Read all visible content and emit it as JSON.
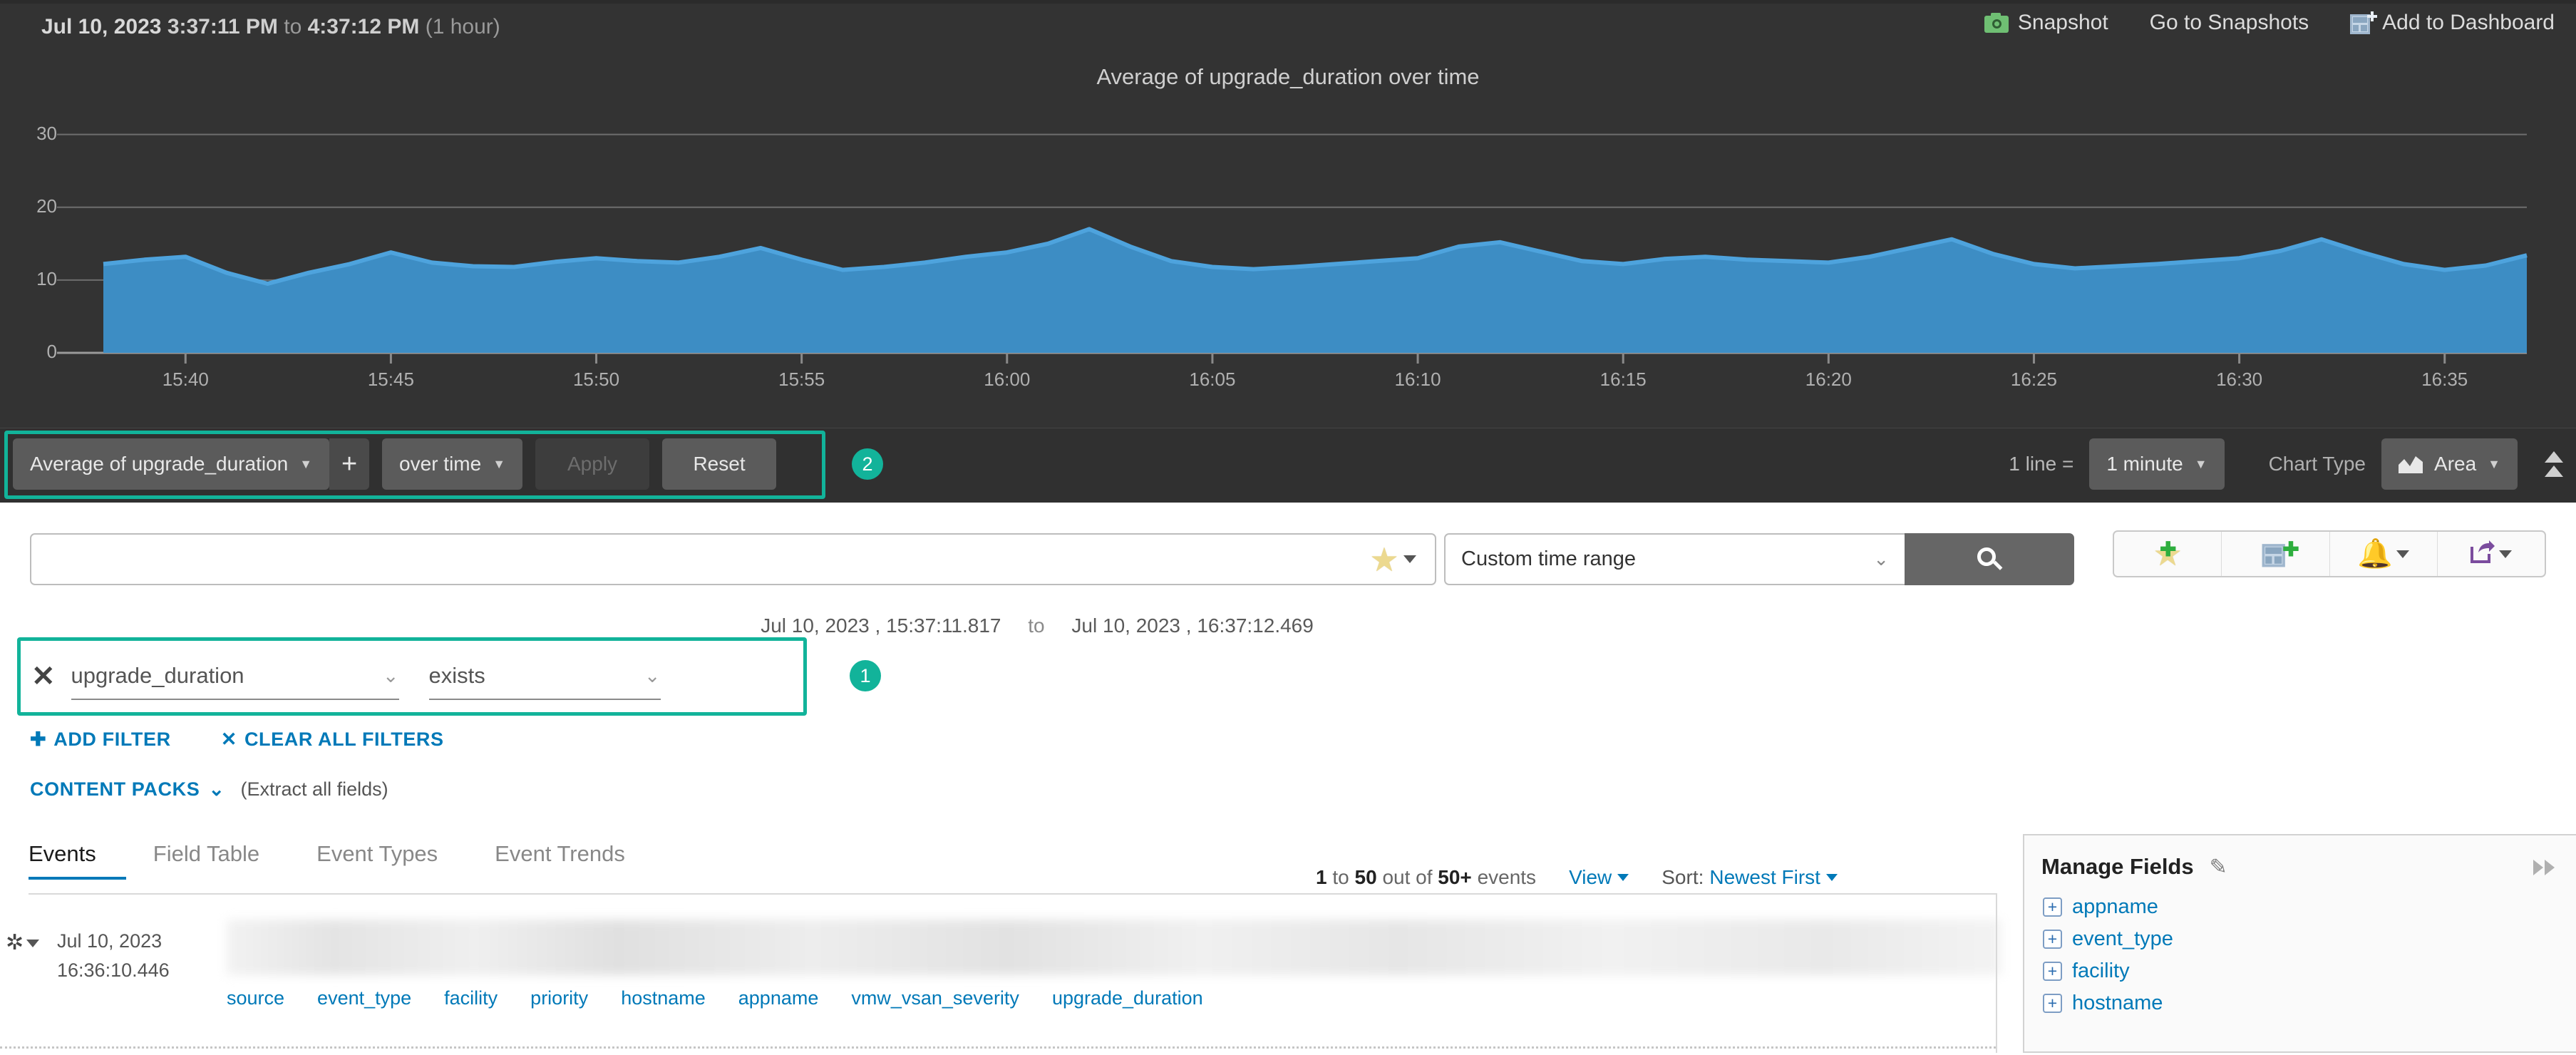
{
  "header": {
    "date": "Jul 10, 2023",
    "time_start": "3:37:11 PM",
    "to_label": "to",
    "time_end": "4:37:12 PM",
    "duration": "(1 hour)",
    "actions": [
      {
        "label": "Snapshot",
        "icon": "camera-icon"
      },
      {
        "label": "Go to Snapshots",
        "icon": "none"
      },
      {
        "label": "Add to Dashboard",
        "icon": "dashboard-plus-icon"
      }
    ]
  },
  "chart_data": {
    "type": "area",
    "title": "Average of upgrade_duration over time",
    "xlabel": "",
    "ylabel": "",
    "ylim": [
      0,
      33
    ],
    "yticks": [
      0,
      10,
      20,
      30
    ],
    "grid": true,
    "legend": "none",
    "series_color": "#3d8dc4",
    "line_color": "#4ea3dd",
    "x_start": "15:37",
    "x_end": "16:37",
    "xticks": [
      "15:40",
      "15:45",
      "15:50",
      "15:55",
      "16:00",
      "16:05",
      "16:10",
      "16:15",
      "16:20",
      "16:25",
      "16:30",
      "16:35"
    ],
    "x": [
      "15:38",
      "15:39",
      "15:40",
      "15:41",
      "15:42",
      "15:43",
      "15:44",
      "15:45",
      "15:46",
      "15:47",
      "15:48",
      "15:49",
      "15:50",
      "15:51",
      "15:52",
      "15:53",
      "15:54",
      "15:55",
      "15:56",
      "15:57",
      "15:58",
      "15:59",
      "16:00",
      "16:01",
      "16:02",
      "16:03",
      "16:04",
      "16:05",
      "16:06",
      "16:07",
      "16:08",
      "16:09",
      "16:10",
      "16:11",
      "16:12",
      "16:13",
      "16:14",
      "16:15",
      "16:16",
      "16:17",
      "16:18",
      "16:19",
      "16:20",
      "16:21",
      "16:22",
      "16:23",
      "16:24",
      "16:25",
      "16:26",
      "16:27",
      "16:28",
      "16:29",
      "16:30",
      "16:31",
      "16:32",
      "16:33",
      "16:34",
      "16:35",
      "16:36",
      "16:37"
    ],
    "values": [
      12.2,
      12.8,
      13.2,
      11.0,
      9.5,
      11.0,
      12.2,
      13.8,
      12.4,
      11.9,
      11.8,
      12.5,
      13.0,
      12.6,
      12.4,
      13.2,
      14.4,
      12.8,
      11.4,
      11.8,
      12.4,
      13.2,
      13.8,
      15.0,
      17.0,
      14.6,
      12.6,
      11.8,
      11.5,
      11.8,
      12.2,
      12.6,
      13.0,
      14.6,
      15.2,
      13.9,
      12.6,
      12.2,
      12.9,
      13.2,
      12.8,
      12.6,
      12.4,
      13.2,
      14.4,
      15.6,
      13.6,
      12.2,
      11.6,
      11.9,
      12.2,
      12.6,
      13.0,
      14.0,
      15.6,
      13.8,
      12.2,
      11.4,
      12.0,
      13.4
    ]
  },
  "agg_toolbar": {
    "function_select": "Average of upgrade_duration",
    "add_label": "+",
    "group_select": "over time",
    "apply_label": "Apply",
    "apply_disabled": true,
    "reset_label": "Reset",
    "line_equals_label": "1 line =",
    "interval_select": "1 minute",
    "chart_type_label": "Chart Type",
    "chart_type_select": "Area"
  },
  "annotations": [
    {
      "badge": "1",
      "target": "filter-row"
    },
    {
      "badge": "2",
      "target": "agg-toolbar"
    }
  ],
  "search": {
    "query": "",
    "placeholder": "",
    "favorites_icon": "star-icon",
    "time_range_select": "Custom time range",
    "search_button_icon": "magnifier-icon",
    "toolbar_icons": [
      {
        "name": "add-favorite-icon",
        "glyph": "star-plus"
      },
      {
        "name": "add-to-dashboard-icon",
        "glyph": "dashboard-plus"
      },
      {
        "name": "alert-icon",
        "glyph": "bell"
      },
      {
        "name": "share-icon",
        "glyph": "share"
      }
    ],
    "range_from": "Jul 10, 2023 , 15:37:11.817",
    "range_to_label": "to",
    "range_to": "Jul 10, 2023 , 16:37:12.469"
  },
  "filters": {
    "rows": [
      {
        "field": "upgrade_duration",
        "operator": "exists"
      }
    ],
    "add_filter_label": "ADD FILTER",
    "clear_all_label": "CLEAR ALL FILTERS",
    "content_packs_label": "CONTENT PACKS",
    "extract_note": "(Extract all fields)"
  },
  "tabs": [
    {
      "label": "Events",
      "active": true
    },
    {
      "label": "Field Table",
      "active": false
    },
    {
      "label": "Event Types",
      "active": false
    },
    {
      "label": "Event Trends",
      "active": false
    }
  ],
  "events": {
    "count_prefix": "1",
    "count_mid": "to",
    "count_shown": "50",
    "count_outof": "out of",
    "count_total": "50+",
    "count_suffix": "events",
    "view_label": "View",
    "sort_prefix": "Sort:",
    "sort_value": "Newest First",
    "row": {
      "date": "Jul 10, 2023",
      "time": "16:36:10.446",
      "fields": [
        "source",
        "event_type",
        "facility",
        "priority",
        "hostname",
        "appname",
        "vmw_vsan_severity",
        "upgrade_duration"
      ]
    }
  },
  "manage_fields": {
    "title": "Manage Fields",
    "edit_icon": "pencil-icon",
    "collapse_icon": "double-chevron-right-icon",
    "items": [
      "appname",
      "event_type",
      "facility",
      "hostname"
    ]
  },
  "colors": {
    "accent_green": "#12b39a",
    "link_blue": "#0079b8",
    "chart_fill": "#3d8dc4",
    "chart_line": "#4ea3dd",
    "dark_bg": "#333333"
  }
}
